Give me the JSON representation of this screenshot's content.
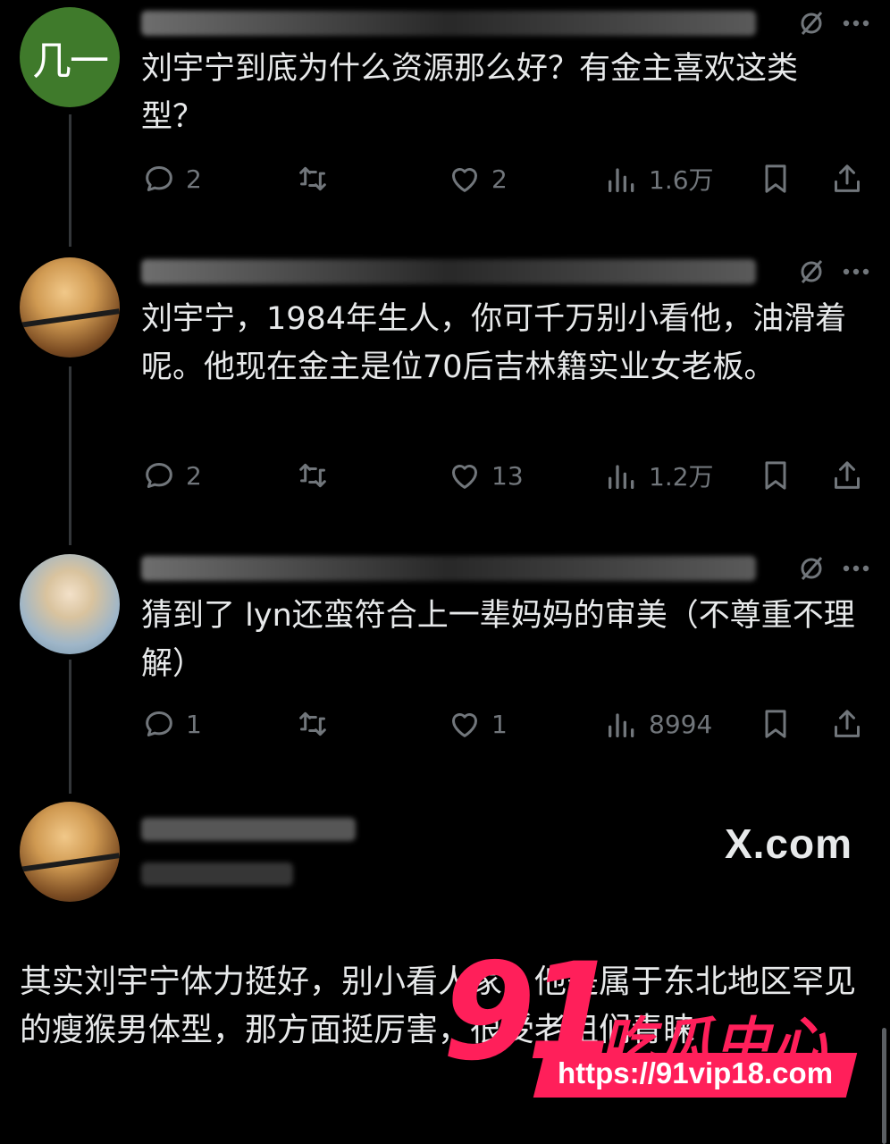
{
  "tweets": [
    {
      "avatar_text": "几一",
      "text": "刘宇宁到底为什么资源那么好？有金主喜欢这类型？",
      "replies": "2",
      "retweets": "",
      "likes": "2",
      "views": "1.6万"
    },
    {
      "avatar_text": "",
      "text": "刘宇宁，1984年生人，你可千万别小看他，油滑着呢。他现在金主是位70后吉林籍实业女老板。",
      "replies": "2",
      "retweets": "",
      "likes": "13",
      "views": "1.2万"
    },
    {
      "avatar_text": "",
      "text": "猜到了 lyn还蛮符合上一辈妈妈的审美（不尊重不理解）",
      "replies": "1",
      "retweets": "",
      "likes": "1",
      "views": "8994"
    }
  ],
  "quote": {
    "source": "X.com",
    "text": "其实刘宇宁体力挺好，别小看人家，他是属于东北地区罕见的瘦猴男体型，那方面挺厉害，很受老姐们青睐"
  },
  "watermark": {
    "number": "91",
    "brand": "吃瓜中心",
    "url": "https://91vip18.com"
  },
  "icons": {
    "reply": "reply-icon",
    "retweet": "retweet-icon",
    "like": "heart-icon",
    "views": "views-icon",
    "bookmark": "bookmark-icon",
    "share": "share-icon",
    "grok": "grok-icon",
    "more": "more-icon"
  },
  "colors": {
    "background": "#000000",
    "text": "#e7e9ea",
    "muted": "#71767b",
    "thread_line": "#333639",
    "watermark": "#ff1f5a",
    "avatar_green": "#3f7a2b"
  }
}
